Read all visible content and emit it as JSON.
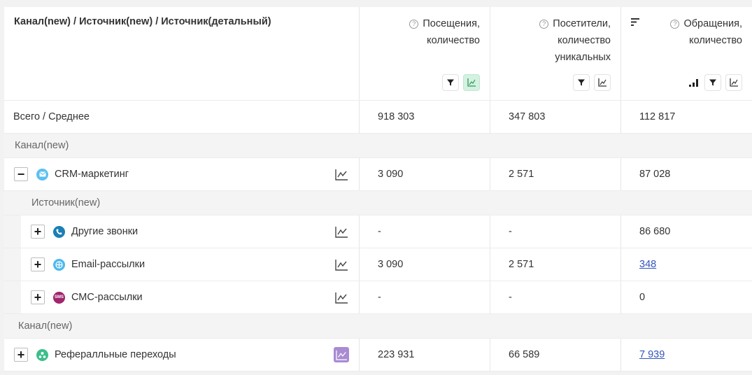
{
  "header": {
    "dimension_title": "Канал(new) / Источник(new) / Источник(детальный)",
    "col_visits": [
      "Посещения,",
      "количество"
    ],
    "col_visitors": [
      "Посетители,",
      "количество",
      "уникальных"
    ],
    "col_requests": [
      "Обращения,",
      "количество"
    ]
  },
  "total": {
    "label": "Всего / Среднее",
    "visits": "918 303",
    "visitors": "347 803",
    "requests": "112 817"
  },
  "group_label": "Канал(new)",
  "sub_group_label": "Источник(new)",
  "rows": [
    {
      "label": "CRM-маркетинг",
      "toggle": "−",
      "icon": "envelope-icon",
      "color": "#5bc0f0",
      "visits": "3 090",
      "visitors": "2 571",
      "requests": "87 028"
    },
    {
      "label": "Другие звонки",
      "toggle": "+",
      "icon": "phone-icon",
      "color": "#1a7fb5",
      "visits": "-",
      "visitors": "-",
      "requests": "86 680"
    },
    {
      "label": "Email-рассылки",
      "toggle": "+",
      "icon": "globe-icon",
      "color": "#4db8f0",
      "visits": "3 090",
      "visitors": "2 571",
      "requests": "348"
    },
    {
      "label": "СМС-рассылки",
      "toggle": "+",
      "icon": "sms-icon",
      "color": "#a0256c",
      "icon_text": "SMS",
      "visits": "-",
      "visitors": "-",
      "requests": "0"
    },
    {
      "label": "Рефералльные переходы",
      "toggle": "+",
      "icon": "referral-icon",
      "color": "#3bbf8a",
      "visits": "223 931",
      "visitors": "66 589",
      "requests": "7 939"
    }
  ],
  "colors": {
    "accent_green": "#d4f1e1",
    "accent_purple": "#a98bd3",
    "link": "#3355bb"
  }
}
